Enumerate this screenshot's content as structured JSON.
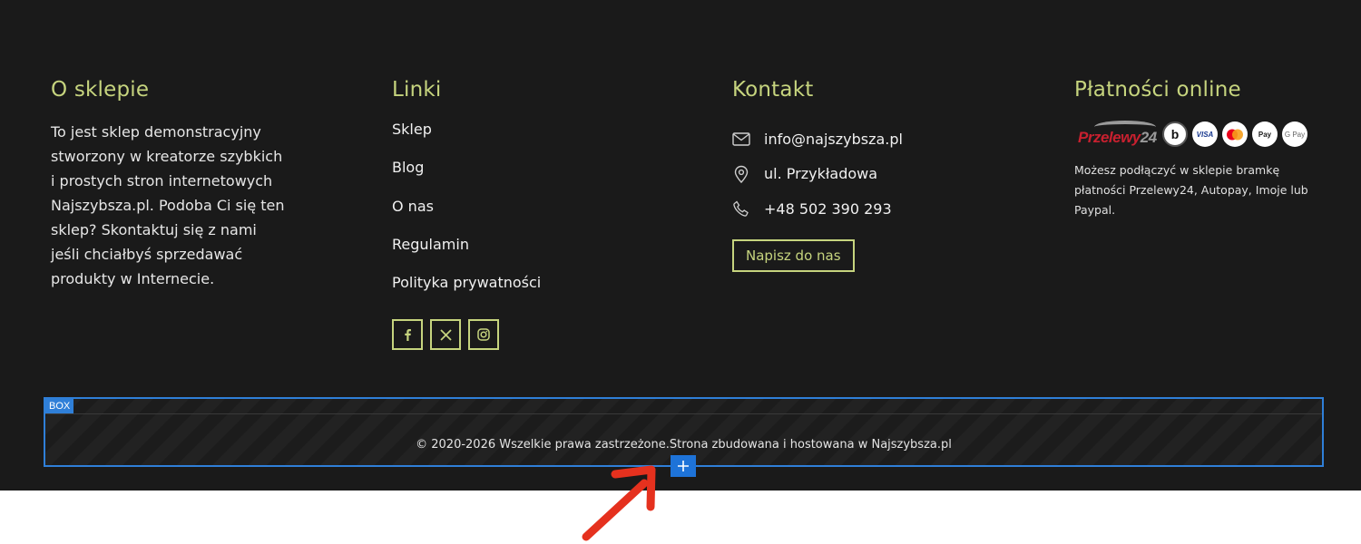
{
  "about": {
    "title": "O sklepie",
    "text": "To jest sklep demonstracyjny stworzony w kreatorze szybkich i prostych stron internetowych Najszybsza.pl. Podoba Ci się ten sklep? Skontaktuj się z nami jeśli chciałbyś sprzedawać produkty w Internecie."
  },
  "links": {
    "title": "Linki",
    "items": [
      "Sklep",
      "Blog",
      "O nas",
      "Regulamin",
      "Polityka prywatności"
    ],
    "social": [
      "facebook-icon",
      "x-icon",
      "instagram-icon"
    ]
  },
  "contact": {
    "title": "Kontakt",
    "email": "info@najszybsza.pl",
    "address": "ul. Przykładowa",
    "phone": "+48 502 390 293",
    "cta": "Napisz do nas"
  },
  "payments": {
    "title": "Płatności online",
    "logos": {
      "przelewy_text": "Przelewy",
      "przelewy_num": "24",
      "blik": "b",
      "visa": "VISA",
      "applepay": "Pay",
      "googlepay": "G Pay"
    },
    "text": "Możesz podłączyć w sklepie bramkę płatności Przelewy24, Autopay, Imoje lub Paypal."
  },
  "footer_box": {
    "tag": "BOX",
    "copyright": "© 2020-2026 Wszelkie prawa zastrzeżone.Strona zbudowana i hostowana w Najszybsza.pl"
  },
  "colors": {
    "accent": "#c6d47e",
    "background": "#1a1a1a",
    "editor_blue": "#2f7fd8",
    "annotation_arrow": "#e5311e"
  }
}
